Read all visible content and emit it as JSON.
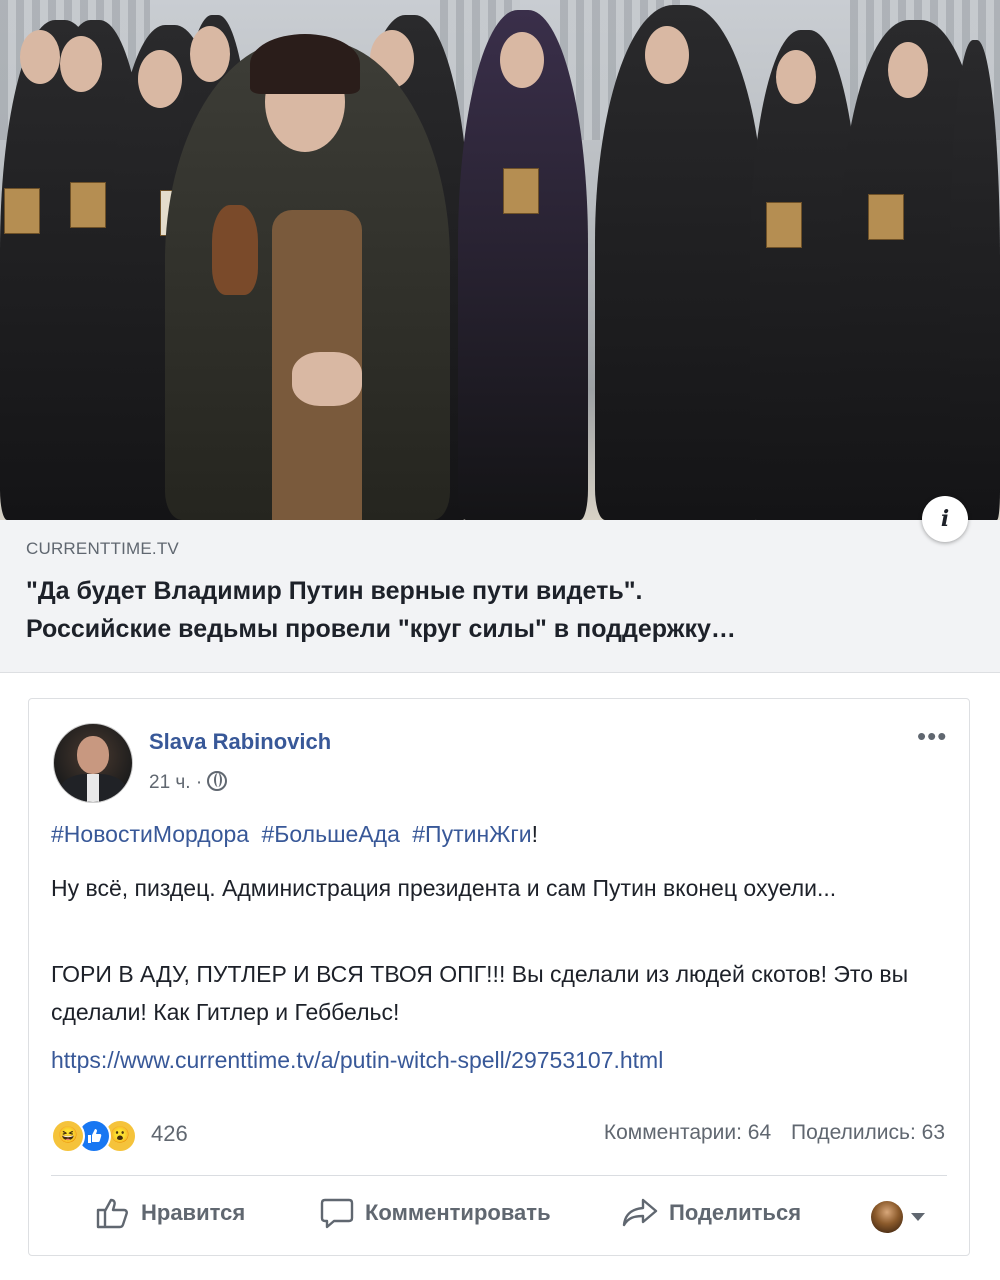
{
  "preview": {
    "domain": "CURRENTTIME.TV",
    "headline_line1": "\"Да будет Владимир Путин верные пути видеть\".",
    "headline_line2": "Российские ведьмы провели \"круг силы\" в поддержку…",
    "info_label": "i"
  },
  "post": {
    "author": "Slava Rabinovich",
    "time": "21 ч.",
    "separator": "·",
    "more": "•••",
    "hashtags": [
      "#НовостиМордора",
      "#БольшеАда",
      "#ПутинЖги"
    ],
    "hashtag_suffix": "!",
    "paragraph1": "Ну всё, пиздец. Администрация президента и сам Путин вконец охуели...",
    "paragraph2": "ГОРИ В АДУ, ПУТЛЕР И ВСЯ ТВОЯ ОПГ!!! Вы сделали из людей скотов! Это вы сделали! Как Гитлер и Геббельс!",
    "link": "https://www.currenttime.tv/a/putin-witch-spell/29753107.html",
    "reactions": {
      "count": "426",
      "icons": [
        "haha-icon",
        "like-icon",
        "wow-icon"
      ]
    },
    "comments": "Комментарии: 64",
    "shares": "Поделились: 63",
    "actions": {
      "like": "Нравится",
      "comment": "Комментировать",
      "share": "Поделиться"
    }
  },
  "colors": {
    "link": "#385898",
    "secondary": "#606770",
    "like_blue": "#1877f2",
    "emoji_yellow": "#f5c33b"
  }
}
